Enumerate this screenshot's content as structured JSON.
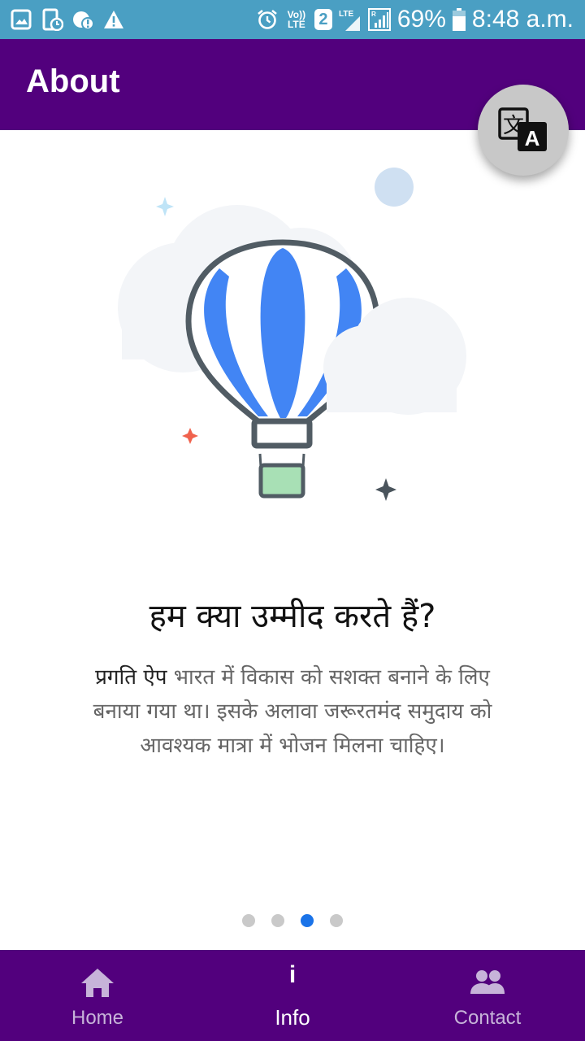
{
  "status_bar": {
    "battery": "69%",
    "time": "8:48 a.m.",
    "sim_slot": "2",
    "network": "LTE",
    "volte": "Vo)) LTE",
    "left_icons": [
      "gallery-icon",
      "screenshot-icon",
      "data-saver-icon",
      "warning-icon"
    ],
    "right_icons": [
      "alarm-icon",
      "volte-icon",
      "sim-2-icon",
      "lte-signal-icon",
      "roaming-signal-icon",
      "battery-icon"
    ]
  },
  "app_bar": {
    "title": "About",
    "translate_icon": "translate-icon"
  },
  "illustration": {
    "icon": "hot-air-balloon-illustration"
  },
  "content": {
    "heading": "हम क्या उम्मीद करते हैं?",
    "lead_text": "प्रगति ऐप",
    "body_text": " भारत में विकास को सशक्त बनाने के लिए बनाया गया था। इसके अलावा जरूरतमंद समुदाय को आवश्यक मात्रा में भोजन मिलना चाहिए।"
  },
  "pager": {
    "total": 4,
    "active_index": 2
  },
  "bottom_nav": {
    "items": [
      {
        "label": "Home",
        "icon": "home-icon",
        "active": false
      },
      {
        "label": "Info",
        "icon": "info-icon",
        "active": true
      },
      {
        "label": "Contact",
        "icon": "people-icon",
        "active": false
      }
    ]
  },
  "colors": {
    "status_bar": "#4a9fc3",
    "primary": "#52007d",
    "fab": "#c8c8c8",
    "dot_active": "#1a73e8",
    "dot_inactive": "#c9c9c9",
    "balloon_blue": "#4285f4"
  }
}
